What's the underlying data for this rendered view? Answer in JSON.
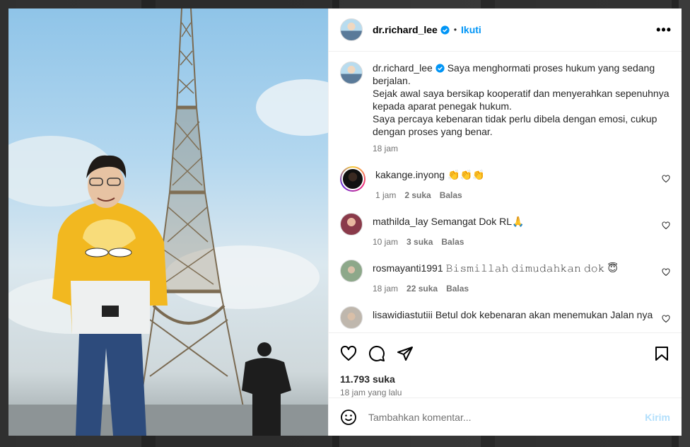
{
  "post": {
    "username": "dr.richard_lee",
    "follow_label": "Ikuti",
    "more_label": "•••",
    "caption": {
      "username": "dr.richard_lee",
      "line1": "Saya menghormati proses hukum yang sedang berjalan.",
      "line2": "Sejak awal saya bersikap kooperatif dan menyerahkan sepenuhnya kepada aparat penegak hukum.",
      "line3": "Saya percaya kebenaran tidak perlu dibela dengan emosi, cukup dengan proses yang benar.",
      "time": "18 jam"
    },
    "comments": [
      {
        "username": "kakange.inyong",
        "text": "👏👏👏",
        "time": "1 jam",
        "likes": "2 suka",
        "reply": "Balas"
      },
      {
        "username": "mathilda_lay",
        "text": "Semangat Dok RL🙏",
        "time": "10 jam",
        "likes": "3 suka",
        "reply": "Balas"
      },
      {
        "username": "rosmayanti1991",
        "text": "𝙱𝚒𝚜𝚖𝚒𝚕𝚕𝚊𝚑 𝚍𝚒𝚖𝚞𝚍𝚊𝚑𝚔𝚊𝚗 𝚍𝚘𝚔 😇",
        "time": "18 jam",
        "likes": "22 suka",
        "reply": "Balas"
      },
      {
        "username": "lisawidiastutiii",
        "text": "Betul dok kebenaran akan menemukan Jalan nya",
        "time": "",
        "likes": "",
        "reply": ""
      }
    ],
    "likes": "11.793 suka",
    "time_ago": "18 jam yang lalu",
    "comment_placeholder": "Tambahkan komentar...",
    "post_label": "Kirim"
  },
  "colors": {
    "accent": "#0095f6",
    "post_disabled": "#b2dffc",
    "hoodie": "#f2b820"
  },
  "icons": [
    "verified-badge-icon",
    "more-icon",
    "heart-icon",
    "comment-icon",
    "share-icon",
    "bookmark-icon",
    "emoji-icon"
  ]
}
